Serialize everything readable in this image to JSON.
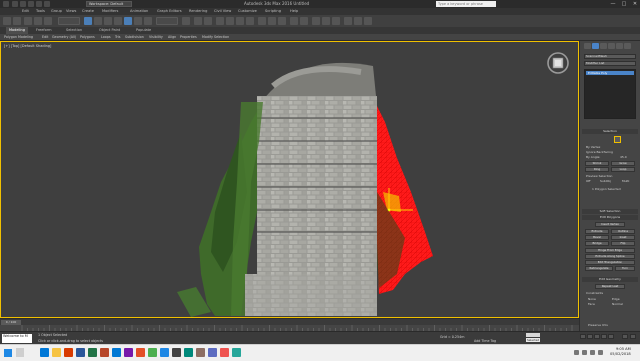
{
  "window": {
    "title": "Autodesk 3ds Max 2016    Untitled",
    "workspace": "Workspace: Default",
    "search_placeholder": "Type a keyword or phrase",
    "controls": [
      "—",
      "□",
      "✕"
    ]
  },
  "menu": [
    "Edit",
    "Tools",
    "Group",
    "Views",
    "Create",
    "Modifiers",
    "Animation",
    "Graph Editors",
    "Rendering",
    "Civil View",
    "Customize",
    "Scripting",
    "Help"
  ],
  "ribbon": {
    "tabs": [
      "Modeling",
      "Freeform",
      "Selection",
      "Object Paint",
      "Populate"
    ],
    "active_tab": "Modeling",
    "commands": [
      "Polygon Modeling",
      "Edit",
      "Geometry (All)",
      "Polygons",
      "Loops",
      "Tris",
      "Subdivision",
      "Visibility",
      "Align",
      "Properties",
      "Modify Selection"
    ]
  },
  "viewport": {
    "label": "[+] [Top] [Default Shading]"
  },
  "command_panel": {
    "object_name": "ScannedMesh",
    "modifier_list": "Modifier List",
    "stack_item": "Editable Poly",
    "selection": {
      "header": "Selection",
      "by_vertex": "By Vertex",
      "ignore_backfacing": "Ignore Backfacing",
      "by_angle": "By Angle:",
      "angle_value": "45.0",
      "shrink": "Shrink",
      "grow": "Grow",
      "ring": "Ring",
      "loop": "Loop",
      "preview_header": "Preview Selection",
      "preview_off": "Off",
      "preview_subobj": "SubObj",
      "preview_multi": "Multi",
      "summary": "1 Polygon Selected"
    },
    "soft_selection": "Soft Selection",
    "edit_polygons": "Edit Polygons",
    "insert_vertex": "Insert Vertex",
    "extrude": "Extrude",
    "outline": "Outline",
    "bevel": "Bevel",
    "inset": "Inset",
    "bridge": "Bridge",
    "flip": "Flip",
    "hinge": "Hinge From Edge",
    "extrude_spline": "Extrude Along Spline",
    "edit_triangulation": "Edit Triangulation",
    "retriangulate": "Retriangulate",
    "turn": "Turn",
    "edit_geometry": "Edit Geometry",
    "repeat_last": "Repeat Last",
    "constraints": "Constraints",
    "none": "None",
    "edge": "Edge",
    "face": "Face",
    "normal": "Normal",
    "preserve_uvs": "Preserve UVs"
  },
  "timeline": {
    "frame": "0 / 100",
    "ticks": [
      "0",
      "10",
      "20",
      "30",
      "40",
      "50",
      "60",
      "70",
      "80",
      "90",
      "100"
    ]
  },
  "status": {
    "maxscript": "Welcome to M",
    "line1": "1 Object Selected",
    "line2": "Click or click-and-drag to select objects",
    "grid": "Grid = 0.254m",
    "add_time_tag": "Add Time Tag",
    "auto_key": "Auto Key",
    "selected": "Selected",
    "set_key": "Set Key",
    "key_filters": "Key Filters..."
  },
  "taskbar": {
    "time": "9:05 AM",
    "date": "05/02/2018"
  },
  "colors": {
    "viewport_bg": "#3f3f3f",
    "selection_red": "#ff1a1a",
    "active_border": "#f0c000",
    "stack_highlight": "#4a84c9"
  }
}
